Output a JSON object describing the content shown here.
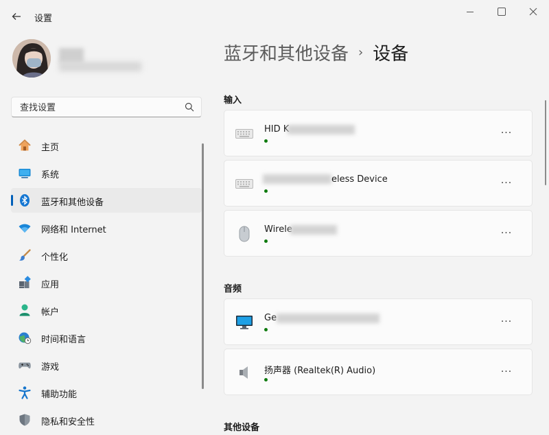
{
  "window": {
    "title": "设置"
  },
  "search": {
    "placeholder": "查找设置"
  },
  "nav": {
    "items": [
      {
        "label": "主页",
        "icon": "home-icon",
        "active": false
      },
      {
        "label": "系统",
        "icon": "display-icon",
        "active": false
      },
      {
        "label": "蓝牙和其他设备",
        "icon": "bluetooth-icon",
        "active": true
      },
      {
        "label": "网络和 Internet",
        "icon": "wifi-icon",
        "active": false
      },
      {
        "label": "个性化",
        "icon": "brush-icon",
        "active": false
      },
      {
        "label": "应用",
        "icon": "apps-icon",
        "active": false
      },
      {
        "label": "帐户",
        "icon": "person-icon",
        "active": false
      },
      {
        "label": "时间和语言",
        "icon": "globe-clock-icon",
        "active": false
      },
      {
        "label": "游戏",
        "icon": "gamepad-icon",
        "active": false
      },
      {
        "label": "辅助功能",
        "icon": "accessibility-icon",
        "active": false
      },
      {
        "label": "隐私和安全性",
        "icon": "shield-icon",
        "active": false
      }
    ]
  },
  "breadcrumb": {
    "parent": "蓝牙和其他设备",
    "separator": "›",
    "current": "设备"
  },
  "sections": {
    "input": {
      "title": "输入",
      "devices": [
        {
          "name": "HID K",
          "icon": "keyboard-icon"
        },
        {
          "name": "eless Device",
          "icon": "keyboard-icon"
        },
        {
          "name": "Wirele",
          "icon": "mouse-icon"
        }
      ]
    },
    "audio": {
      "title": "音频",
      "devices": [
        {
          "name": "Ge",
          "icon": "monitor-icon"
        },
        {
          "name": "扬声器 (Realtek(R) Audio)",
          "icon": "speaker-icon"
        }
      ]
    },
    "other": {
      "title": "其他设备"
    }
  },
  "more_label": "···",
  "colors": {
    "accent": "#005fb8",
    "connected": "#0f7b0f",
    "background": "#f3f3f3",
    "card": "#fbfbfb"
  }
}
